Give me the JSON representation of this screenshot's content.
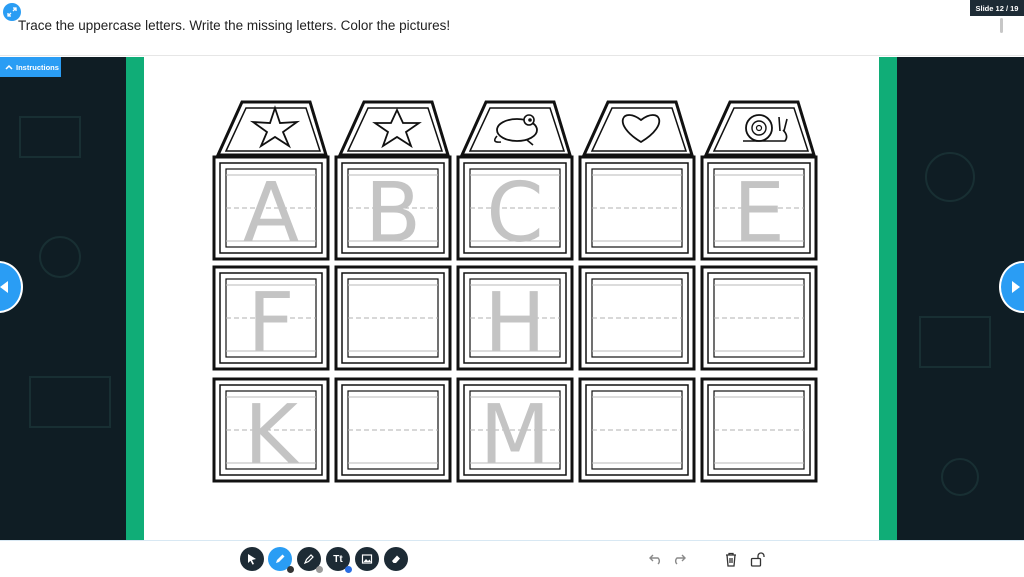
{
  "header": {
    "instruction": "Trace the uppercase letters. Write the missing letters. Color the pictures!",
    "slide_counter": "Slide 12 / 19"
  },
  "stage": {
    "instructions_tab_label": "Instructions"
  },
  "worksheet": {
    "top_pictures": [
      "starfish",
      "star",
      "frog",
      "heart",
      "snail"
    ],
    "rows": [
      [
        "A",
        "B",
        "C",
        "",
        "E"
      ],
      [
        "F",
        "",
        "H",
        "",
        ""
      ],
      [
        "K",
        "",
        "M",
        "",
        ""
      ]
    ]
  },
  "toolbar": {
    "tools": [
      "select-tool",
      "pen-tool",
      "highlighter-tool",
      "text-tool",
      "image-tool",
      "eraser-tool"
    ],
    "text_tool_label": "Tt",
    "active_tool": "pen-tool"
  },
  "colors": {
    "accent": "#2a9df4",
    "dark": "#1d2b35",
    "green": "#10ad77",
    "stage_bg": "#0f1d24"
  }
}
